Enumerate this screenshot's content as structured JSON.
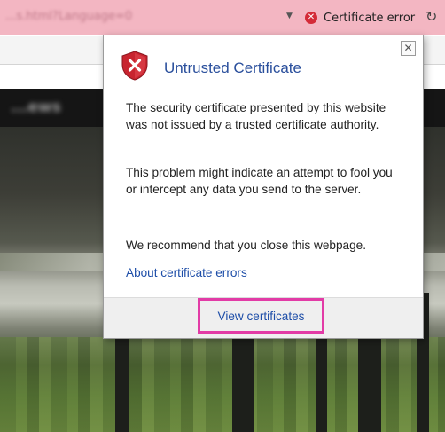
{
  "address_bar": {
    "url": "...s.html?Language=0",
    "certificate_error_label": "Certificate error",
    "dropdown_icon": "chevron-down-icon",
    "error_icon": "error-circle-icon",
    "refresh_icon": "refresh-icon"
  },
  "background_page": {
    "blurred_heading": "...ews"
  },
  "popup": {
    "title": "Untrusted Certificate",
    "paragraphs": [
      "The security certificate presented by this website was not issued by a trusted certificate authority.",
      "This problem might indicate an attempt to fool you or intercept any data you send to the server.",
      "We recommend that you close this webpage."
    ],
    "about_link": "About certificate errors",
    "view_certificates_label": "View certificates",
    "close_icon": "close-icon",
    "shield_icon": "shield-error-icon"
  },
  "colors": {
    "address_bar_error": "#f3b6c2",
    "title_blue": "#2a4f9c",
    "link_blue": "#1e4ea8",
    "highlight_magenta": "#e23ba6",
    "error_red": "#d42b38"
  }
}
